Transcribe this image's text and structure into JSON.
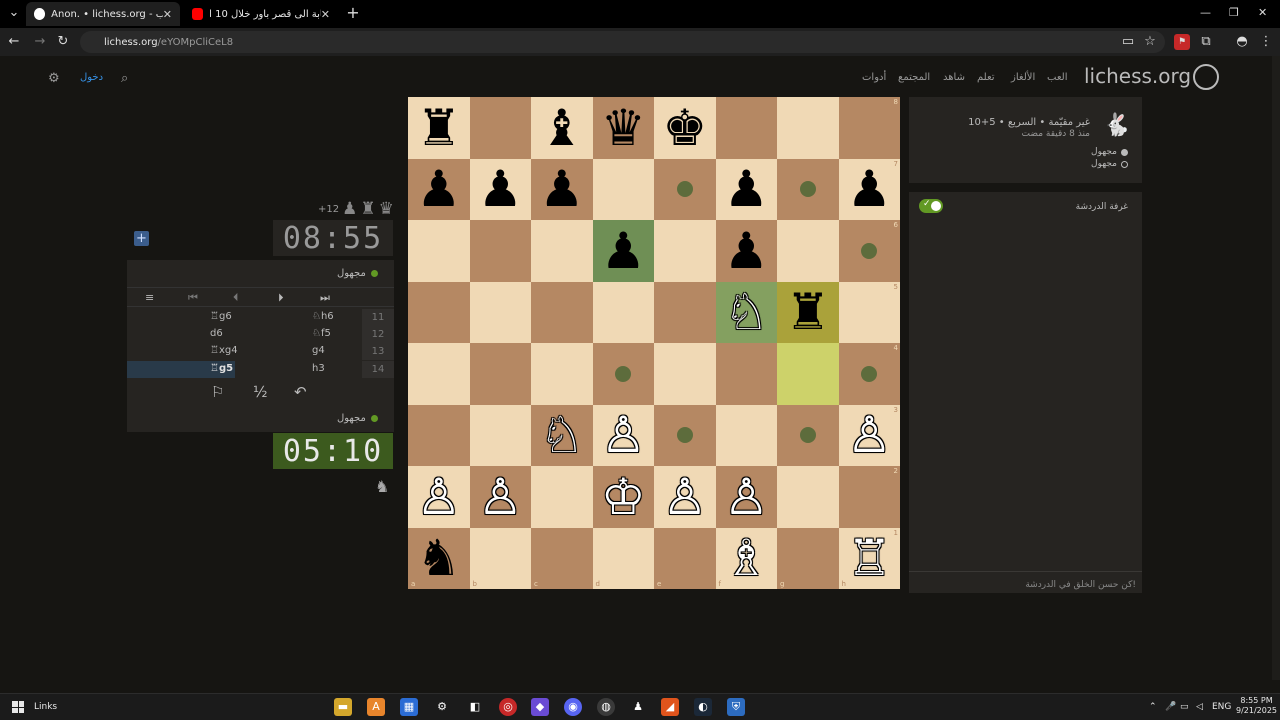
{
  "browser": {
    "tabs": [
      {
        "title": "دورك - العب • lichess.org",
        "prefix": "Anon. • lichess.org"
      },
      {
        "title": "من الغابة الى قصر باور خلال 10 ا..."
      }
    ],
    "tab1_label": "Anon. • lichess.org - دورك - العب",
    "tab2_label": "من الغابة الى قصر باور خلال 10 ا...",
    "url_host": "lichess.org",
    "url_path": "/eYOMpCliCeL8"
  },
  "header": {
    "logo": "lichess.org",
    "nav": [
      "العب",
      "الألغاز",
      "تعلم",
      "شاهد",
      "المجتمع",
      "أدوات"
    ],
    "login": "دخول"
  },
  "board": {
    "ranks": [
      "8",
      "7",
      "6",
      "5",
      "4",
      "3",
      "2",
      "1"
    ],
    "files": [
      "a",
      "b",
      "c",
      "d",
      "e",
      "f",
      "g",
      "h"
    ],
    "squares": [
      [
        "♜",
        "",
        "♝",
        "♛",
        "♚",
        "",
        "",
        ""
      ],
      [
        "♟",
        "♟",
        "♟",
        "",
        "•",
        "♟",
        "•",
        "♟"
      ],
      [
        "",
        "",
        "",
        "♟",
        "",
        "♟",
        "",
        "•"
      ],
      [
        "",
        "",
        "",
        "",
        "",
        "♘",
        "♜",
        ""
      ],
      [
        "",
        "",
        "",
        "•",
        "",
        "",
        "",
        "•"
      ],
      [
        "",
        "",
        "♘",
        "♙",
        "•",
        "",
        "•",
        "♙"
      ],
      [
        "♙",
        "♙",
        "",
        "♔",
        "♙",
        "♙",
        "",
        ""
      ],
      [
        "♞",
        "",
        "",
        "",
        "",
        "♗",
        "",
        "♖"
      ]
    ],
    "colors": [
      [
        "b",
        "",
        "b",
        "b",
        "b",
        "",
        "",
        ""
      ],
      [
        "b",
        "b",
        "b",
        "",
        "",
        "b",
        "",
        "b"
      ],
      [
        "",
        "",
        "",
        "b",
        "",
        "b",
        "",
        ""
      ],
      [
        "",
        "",
        "",
        "",
        "",
        "w",
        "b",
        ""
      ],
      [
        "",
        "",
        "",
        "",
        "",
        "",
        "",
        ""
      ],
      [
        "",
        "",
        "w",
        "w",
        "",
        "",
        "",
        "w"
      ],
      [
        "w",
        "w",
        "",
        "w",
        "w",
        "w",
        "",
        ""
      ],
      [
        "b",
        "",
        "",
        "",
        "",
        "w",
        "",
        "w"
      ]
    ]
  },
  "clocks": {
    "top": "08:55",
    "bottom": "05:10"
  },
  "material": "+12",
  "players": {
    "top": "مجهول",
    "bottom": "مجهول"
  },
  "moves": [
    {
      "num": "11",
      "white": "♘h6",
      "black": "♖g6"
    },
    {
      "num": "12",
      "white": "♘f5",
      "black": "d6"
    },
    {
      "num": "13",
      "white": "g4",
      "black": "♖xg4"
    },
    {
      "num": "14",
      "white": "h3",
      "black": "♖g5"
    }
  ],
  "game_info": {
    "line1": "10+5 • غير مقيّمة • السريع",
    "line2": "منذ 8 دقيقة مضت",
    "player_white": "مجهول",
    "player_black": "مجهول"
  },
  "chat": {
    "title": "غرفة الدردشة",
    "placeholder": "كن حسن الخلق في الدردشة!"
  },
  "taskbar": {
    "links": "Links",
    "lang": "ENG",
    "time": "8:55 PM",
    "date": "9/21/2025"
  },
  "colors": {
    "board_light": "#f0d9b5",
    "board_dark": "#b58863",
    "accent_green": "#629924",
    "link_blue": "#3692e7"
  }
}
